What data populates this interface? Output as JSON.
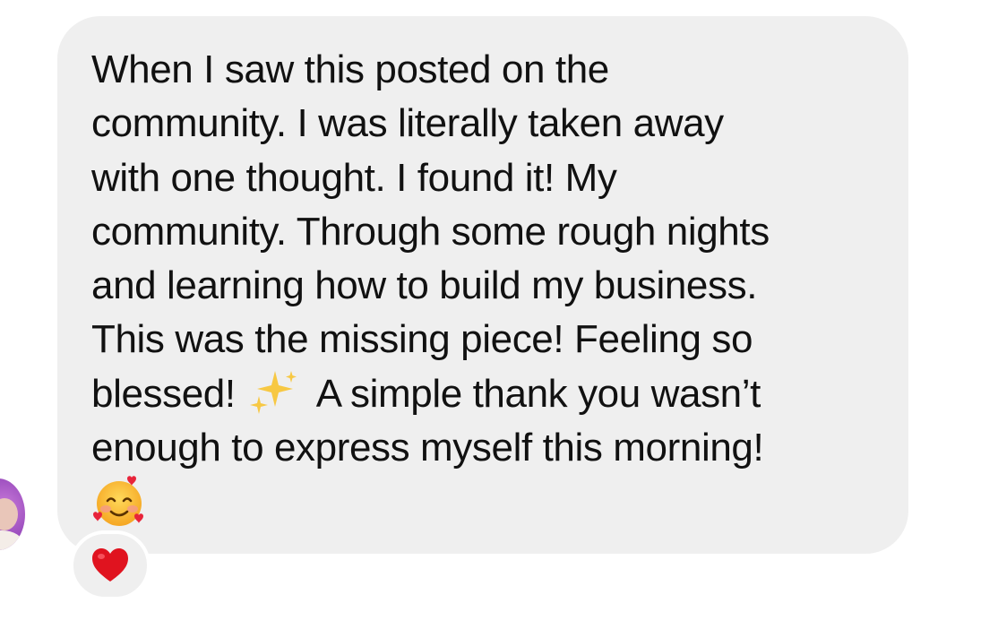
{
  "message": {
    "line_1": "When I saw this posted on the",
    "line_2": "community. I was literally taken away",
    "line_3": "with one thought. I found it! My",
    "line_4": "community. Through some rough nights",
    "line_5": "and learning how to build my business.",
    "line_6": "This was the missing piece! Feeling so",
    "line_7a": "blessed!",
    "line_7b": "A simple thank you wasn’t",
    "line_8": "enough to express myself this morning!",
    "emoji_inline": "sparkles-emoji",
    "emoji_end": "smiling-face-with-hearts-emoji"
  },
  "reaction": {
    "icon": "red-heart-emoji",
    "color": "#e0131f"
  },
  "bubble_color": "#efefef",
  "avatar_color": "#9d4fbf"
}
